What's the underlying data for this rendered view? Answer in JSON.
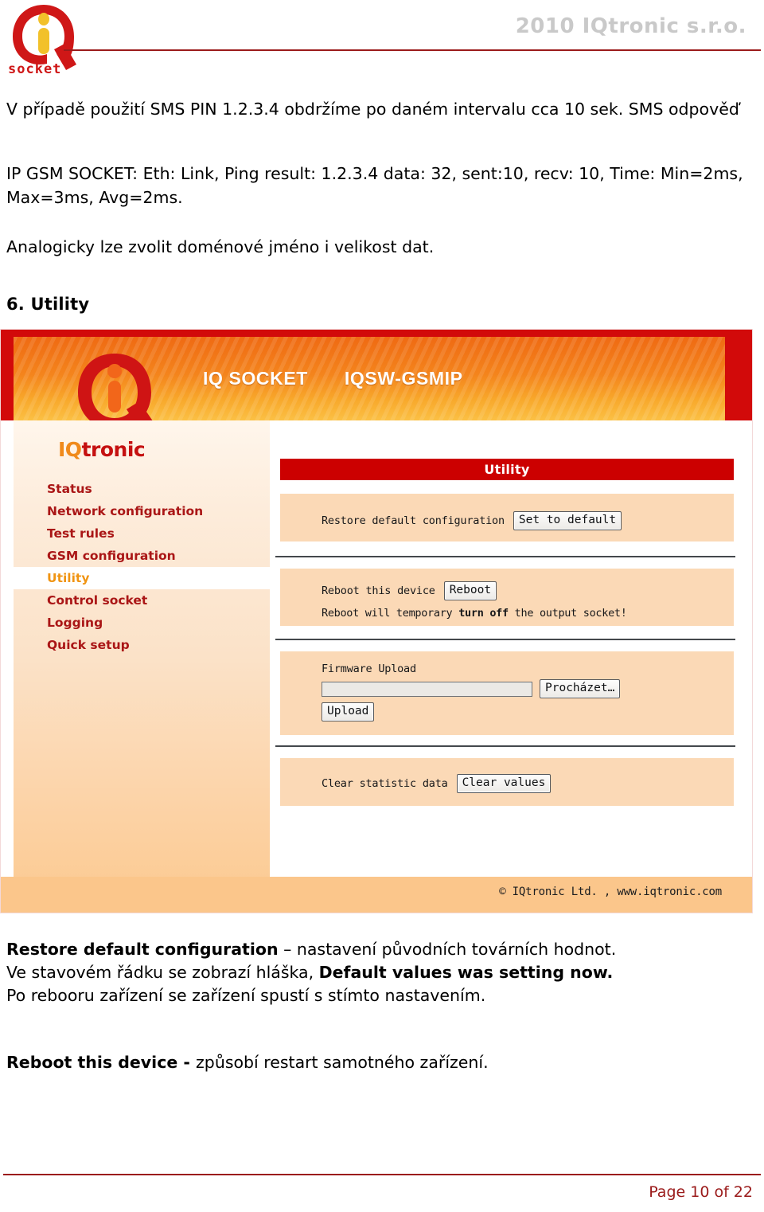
{
  "header": {
    "corp_text": "2010 IQtronic  s.r.o.",
    "logo_alt": "iq-socket-logo",
    "logo_sub": "socket"
  },
  "document": {
    "paragraph_1": "V případě použití  SMS PIN 1.2.3.4 obdržíme po daném intervalu cca 10 sek. SMS odpověď",
    "paragraph_2": "IP GSM SOCKET: Eth: Link, Ping result: 1.2.3.4 data: 32, sent:10, recv: 10, Time: Min=2ms, Max=3ms, Avg=2ms.",
    "paragraph_3": "Analogicky lze zvolit doménové jméno i velikost dat.",
    "section_title": "6. Utility"
  },
  "screenshot": {
    "banner": {
      "brand": "IQ SOCKET",
      "model": "IQSW-GSMIP"
    },
    "sidebar": {
      "wordmark_iq": "IQ",
      "wordmark_tronic": "tronic",
      "items": [
        {
          "label": "Status",
          "active": false
        },
        {
          "label": "Network configuration",
          "active": false
        },
        {
          "label": "Test rules",
          "active": false
        },
        {
          "label": "GSM configuration",
          "active": false
        },
        {
          "label": "Utility",
          "active": true
        },
        {
          "label": "Control socket",
          "active": false
        },
        {
          "label": "Logging",
          "active": false
        },
        {
          "label": "Quick setup",
          "active": false
        }
      ]
    },
    "panel": {
      "title": "Utility",
      "restore": {
        "label": "Restore default configuration",
        "button": "Set to default"
      },
      "reboot": {
        "label": "Reboot this device",
        "button": "Reboot",
        "note_prefix": "Reboot will temporary ",
        "note_bold": "turn off",
        "note_suffix": " the output socket!"
      },
      "firmware": {
        "label": "Firmware Upload",
        "input_value": "",
        "browse_button": "Procházet…",
        "upload_button": "Upload"
      },
      "clear": {
        "label": "Clear statistic data",
        "button": "Clear values"
      }
    },
    "footer": "© IQtronic Ltd. , www.iqtronic.com"
  },
  "notes": {
    "block1_bold1": "Restore default configuration",
    "block1_text1": " – nastavení původních továrních hodnot.",
    "block1_text2a": "Ve stavovém řádku se zobrazí hláška, ",
    "block1_bold2": "Default values was setting now.",
    "block1_text3": "Po rebooru zařízení se zařízení spustí s stímto nastavením.",
    "block2_bold": "Reboot this device - ",
    "block2_text": " způsobí restart samotného zařízení."
  },
  "page_footer": {
    "page_number": "Page 10 of 22"
  },
  "colors": {
    "brand_red": "#c51111",
    "banner_red": "#d20a0a",
    "panel_red": "#cc0000",
    "accent_orange": "#f08a1b",
    "rule_red": "#9b1b1b",
    "panel_beige": "#fbd9b6",
    "footer_beige": "#fbc68b"
  }
}
